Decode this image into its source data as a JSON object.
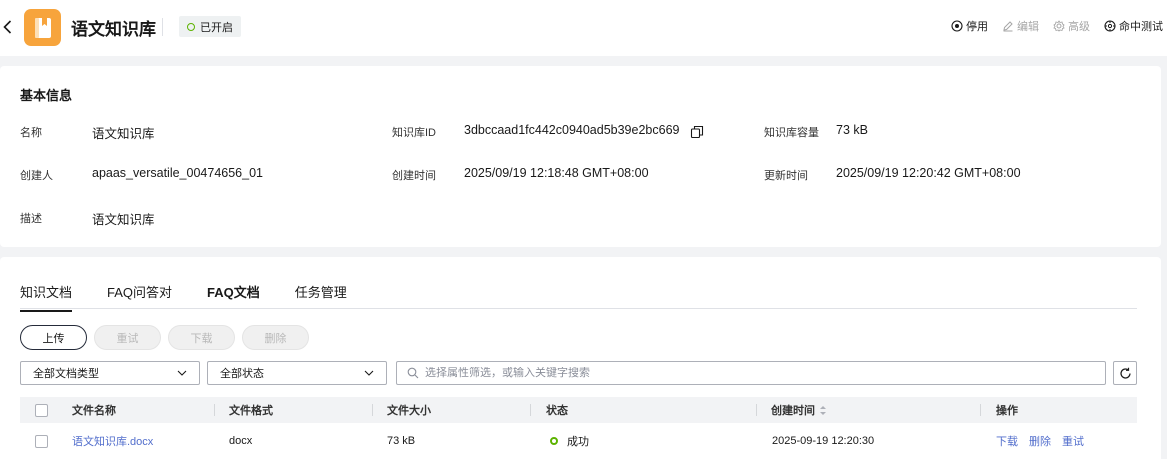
{
  "header": {
    "title": "语文知识库",
    "status": "已开启",
    "actions": [
      {
        "label": "停用",
        "icon": "stop-circle-icon",
        "disabled": false
      },
      {
        "label": "编辑",
        "icon": "pencil-icon",
        "disabled": true
      },
      {
        "label": "高级",
        "icon": "gear-icon",
        "disabled": true
      },
      {
        "label": "命中测试",
        "icon": "target-icon",
        "disabled": false
      }
    ]
  },
  "basic_info": {
    "title": "基本信息",
    "name_label": "名称",
    "name_value": "语文知识库",
    "id_label": "知识库ID",
    "id_value": "3dbccaad1fc442c0940ad5b39e2bc669",
    "size_label": "知识库容量",
    "size_value": "73 kB",
    "creator_label": "创建人",
    "creator_value": "apaas_versatile_00474656_01",
    "created_label": "创建时间",
    "created_value": "2025/09/19 12:18:48 GMT+08:00",
    "updated_label": "更新时间",
    "updated_value": "2025/09/19 12:20:42 GMT+08:00",
    "desc_label": "描述",
    "desc_value": "语文知识库"
  },
  "tabs": [
    {
      "label": "知识文档",
      "active": true
    },
    {
      "label": "FAQ问答对",
      "active": false
    },
    {
      "label": "FAQ文档",
      "active": false
    },
    {
      "label": "任务管理",
      "active": false
    }
  ],
  "toolbar": {
    "upload": "上传",
    "retry": "重试",
    "download": "下载",
    "delete": "删除"
  },
  "filters": {
    "doc_type": "全部文档类型",
    "status": "全部状态",
    "search_placeholder": "选择属性筛选，或输入关键字搜索"
  },
  "table": {
    "columns": [
      "文件名称",
      "文件格式",
      "文件大小",
      "状态",
      "创建时间",
      "操作"
    ],
    "rows": [
      {
        "name": "语文知识库.docx",
        "format": "docx",
        "size": "73 kB",
        "status": "成功",
        "created": "2025-09-19 12:20:30",
        "ops": [
          "下载",
          "删除",
          "重试"
        ]
      }
    ]
  },
  "colors": {
    "accent": "#526ecc",
    "success": "#5cb300",
    "app_icon": "#f7a43c"
  }
}
